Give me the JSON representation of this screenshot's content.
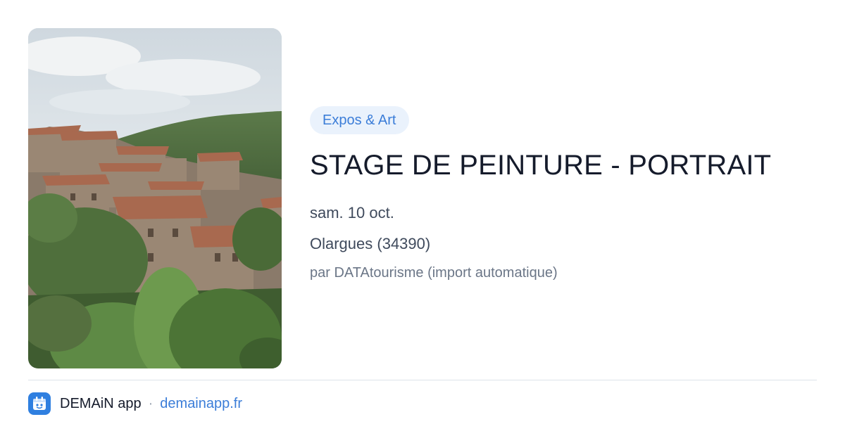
{
  "event": {
    "category": "Expos & Art",
    "title": "STAGE DE PEINTURE - PORTRAIT",
    "date": "sam. 10 oct.",
    "location": "Olargues (34390)",
    "author": "par DATAtourisme (import automatique)"
  },
  "footer": {
    "brand": "DEMAiN app",
    "separator": "·",
    "website": "demainapp.fr"
  },
  "icons": {
    "logo": "demain-app-logo-icon"
  },
  "colors": {
    "accent": "#3b7dd8",
    "tag_background": "#eaf2fc",
    "title": "#151b2b",
    "text": "#3f4a5c",
    "muted": "#6b7687"
  }
}
